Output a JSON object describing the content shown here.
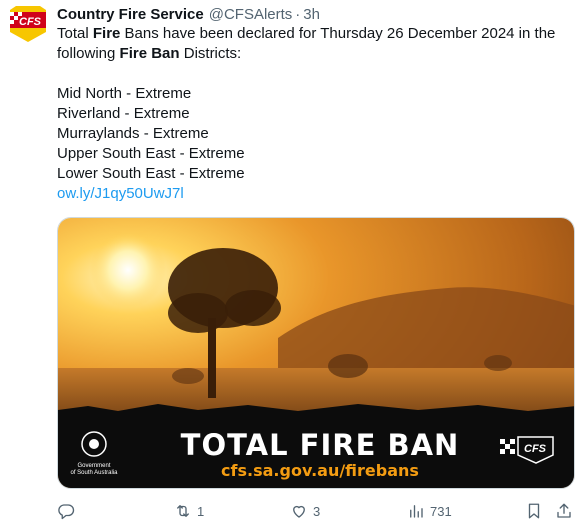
{
  "tweet": {
    "author_name": "Country Fire Service",
    "handle": "@CFSAlerts",
    "separator": "·",
    "time": "3h",
    "text": {
      "intro_1": "Total ",
      "intro_bold_1": "Fire",
      "intro_2": " Bans have been declared for Thursday 26 December 2024 in the",
      "intro_3": "following ",
      "intro_bold_2": "Fire Ban",
      "intro_4": " Districts:",
      "districts": [
        "Mid North - Extreme",
        "Riverland - Extreme",
        "Murraylands - Extreme",
        "Upper South East - Extreme",
        "Lower South East - Extreme"
      ],
      "link": "ow.ly/J1qy50UwJ7l"
    },
    "avatar_text": "CFS",
    "image": {
      "headline": "TOTAL FIRE BAN",
      "url": "cfs.sa.gov.au/firebans",
      "gov_line_1": "Government",
      "gov_line_2": "of South Australia",
      "logo_text": "CFS"
    },
    "actions": {
      "reply_count": "",
      "retweet_count": "1",
      "like_count": "3",
      "views_count": "731"
    }
  },
  "colors": {
    "link": "#1d9bf0",
    "muted": "#536471",
    "brand_orange": "#f39c12",
    "brand_red": "#d0021b"
  },
  "icons": [
    "reply-icon",
    "retweet-icon",
    "like-icon",
    "views-icon",
    "bookmark-icon",
    "share-icon"
  ]
}
